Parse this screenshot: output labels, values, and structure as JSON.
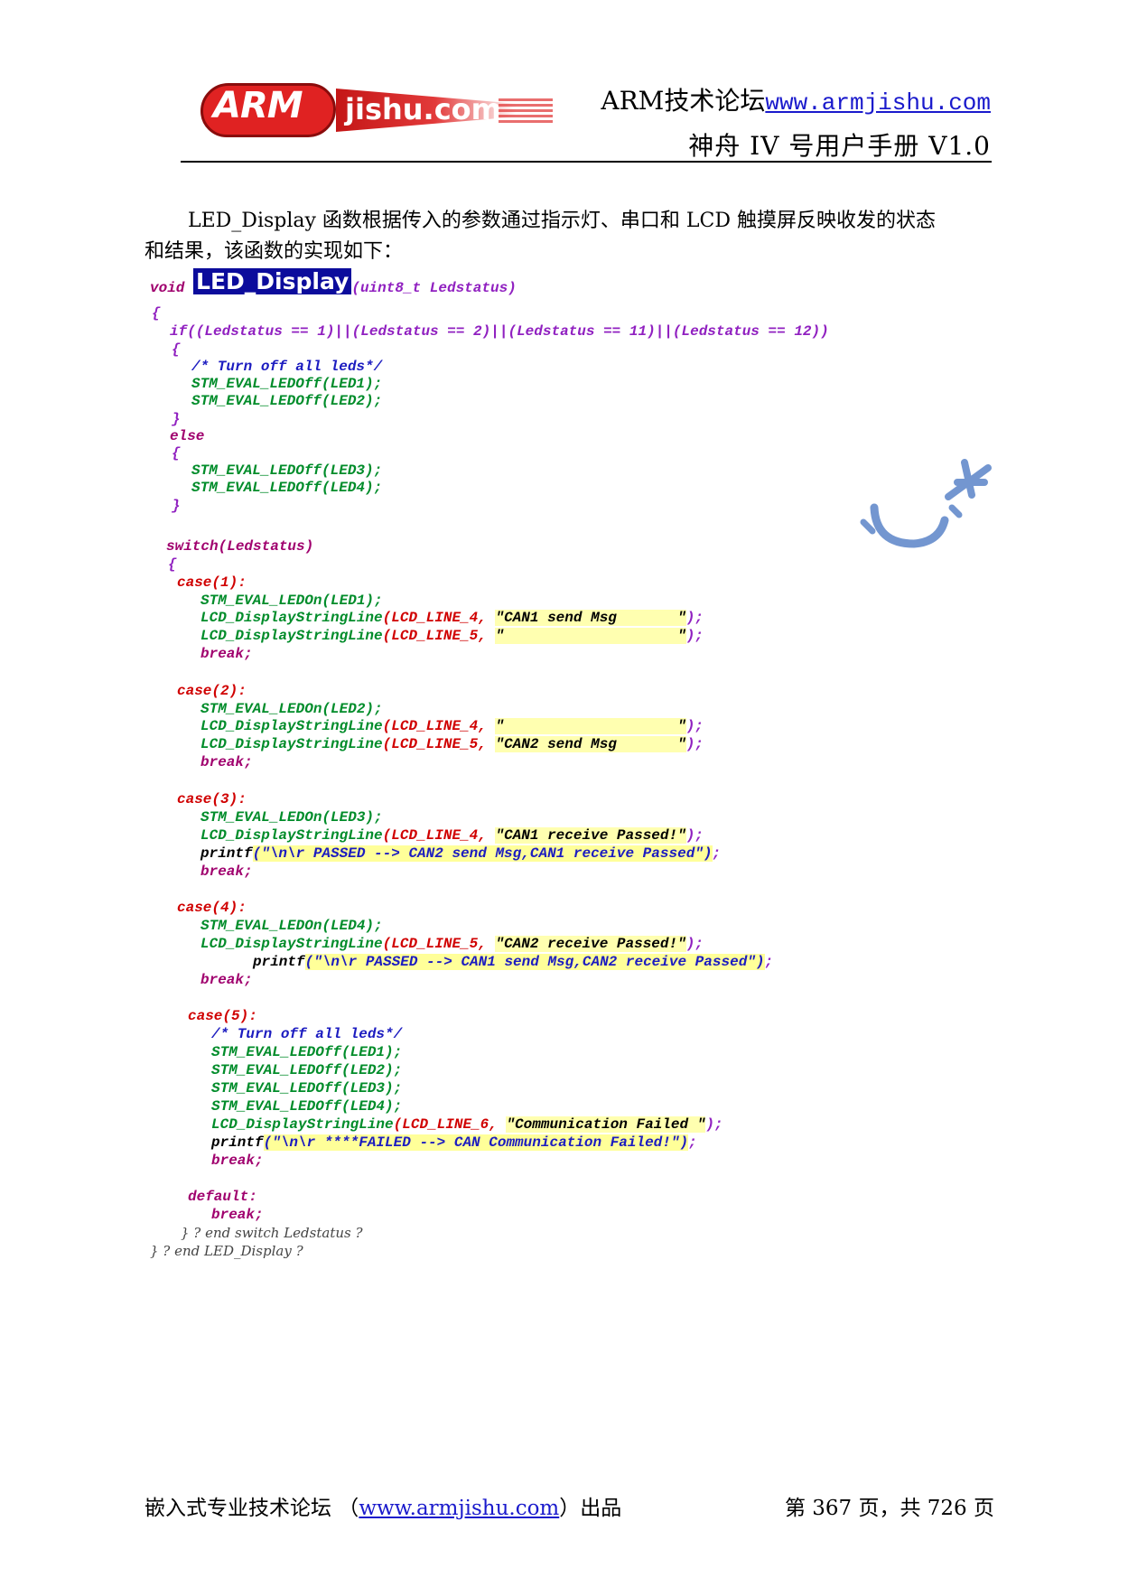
{
  "header": {
    "logo_badge": "ARM",
    "logo_wordmark": "jishu.com",
    "forum_label": "ARM技术论坛",
    "forum_url": "www.armjishu.com",
    "manual_title": "神舟 IV 号用户手册 V1.0"
  },
  "intro": {
    "line1": "LED_Display 函数根据传入的参数通过指示灯、串口和 LCD 触摸屏反映收发的状态",
    "line2": "和结果，该函数的实现如下："
  },
  "code": {
    "sig_void": "void",
    "sig_name": "LED_Display",
    "sig_params": "(uint8_t Ledstatus)",
    "if_line": "if((Ledstatus == 1)||(Ledstatus == 2)||(Ledstatus == 11)||(Ledstatus == 12))",
    "comment_off": "/* Turn off all leds*/",
    "led1_off": "STM_EVAL_LEDOff(LED1);",
    "led2_off": "STM_EVAL_LEDOff(LED2);",
    "led3_off": "STM_EVAL_LEDOff(LED3);",
    "led4_off": "STM_EVAL_LEDOff(LED4);",
    "else_kw": "else",
    "switch_line": "switch(Ledstatus)",
    "case1": "case(1):",
    "case2": "case(2):",
    "case3": "case(3):",
    "case4": "case(4):",
    "case5": "case(5):",
    "led1_on": "STM_EVAL_LEDOn(LED1);",
    "led2_on": "STM_EVAL_LEDOn(LED2);",
    "led3_on": "STM_EVAL_LEDOn(LED3);",
    "led4_on": "STM_EVAL_LEDOn(LED4);",
    "lcd_fn": "LCD_DisplayStringLine",
    "line4": "(LCD_LINE_4,",
    "line5": "(LCD_LINE_5,",
    "line6": "(LCD_LINE_6,",
    "str_can1_send": "\"CAN1 send Msg       \"",
    "str_blank": "\"                    \"",
    "str_can2_send": "\"CAN2 send Msg       \"",
    "str_can1_recv": "\"CAN1 receive Passed!\"",
    "str_can2_recv": "\"CAN2 receive Passed!\"",
    "str_comm_failed": "\"Communication Failed \"",
    "end_paren": ");",
    "printf_kw": "printf",
    "printf_3": "(\"\\n\\r PASSED --> CAN2 send Msg,CAN1 receive Passed\")",
    "printf_4": "(\"\\n\\r PASSED --> CAN1 send Msg,CAN2 receive Passed\")",
    "printf_5": "(\"\\n\\r ****FAILED --> CAN Communication Failed!\")",
    "semi": ";",
    "break_kw": "break;",
    "default_kw": "default:",
    "end_switch": "} ? end switch Ledstatus ?",
    "end_fn": "} ? end LED_Display ?",
    "open_brace": "{",
    "close_brace": "}"
  },
  "footer": {
    "left_prefix": "嵌入式专业技术论坛 （",
    "left_url": "www.armjishu.com",
    "left_suffix": "）出品",
    "right": "第 367 页，共 726 页"
  }
}
